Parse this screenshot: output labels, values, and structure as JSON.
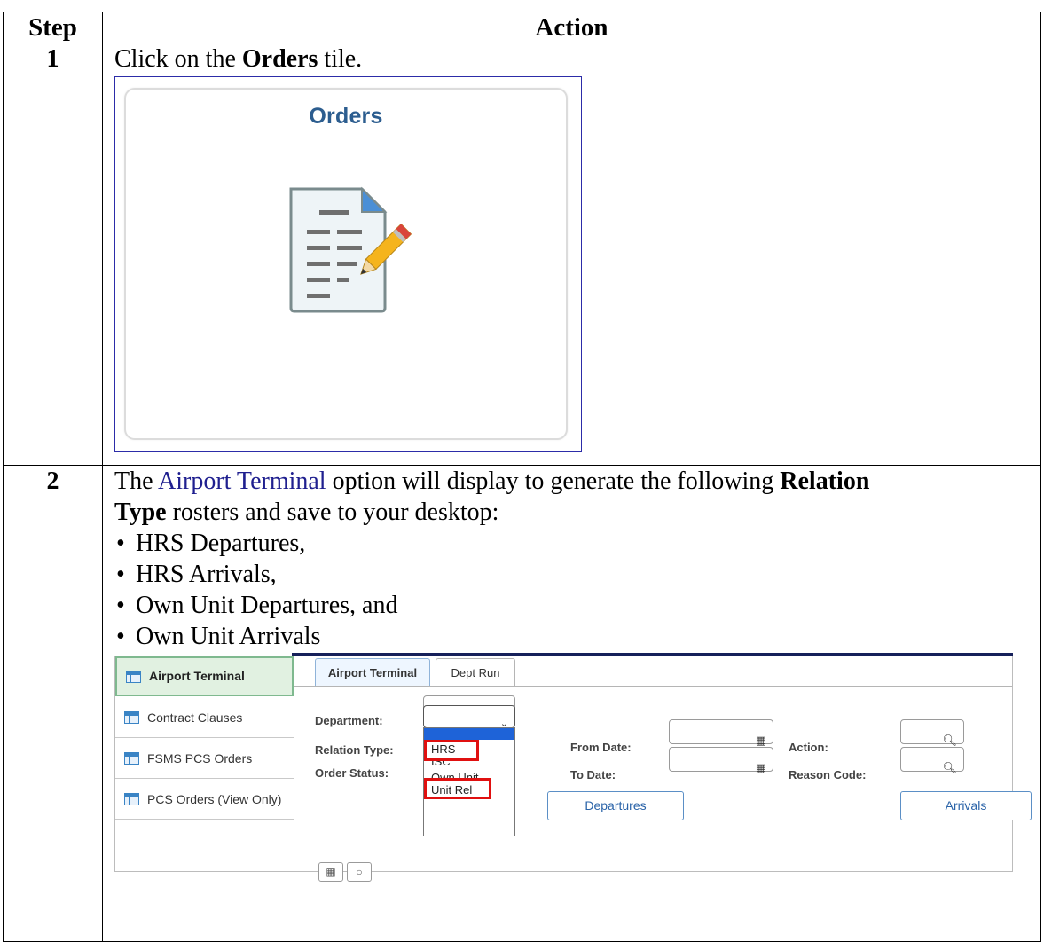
{
  "table": {
    "header_step": "Step",
    "header_action": "Action"
  },
  "step1": {
    "number": "1",
    "pre": "Click on the ",
    "bold": "Orders",
    "post": " tile.",
    "tile_title": "Orders",
    "tile_icon": "document-pencil-icon"
  },
  "step2": {
    "number": "2",
    "pre": "The ",
    "link_text": "Airport Terminal",
    "mid": " option will display to generate the following ",
    "bold1": "Relation",
    "bold2": "Type",
    "post": " rosters and save to your desktop:",
    "bullets": [
      "HRS Departures,",
      "HRS Arrivals,",
      "Own Unit Departures, and",
      "Own Unit Arrivals"
    ]
  },
  "screenshot": {
    "nav_items": [
      {
        "label": "Airport Terminal",
        "active": true
      },
      {
        "label": "Contract Clauses",
        "active": false
      },
      {
        "label": "FSMS PCS Orders",
        "active": false
      },
      {
        "label": "PCS Orders (View Only)",
        "active": false
      }
    ],
    "tabs": [
      "Airport Terminal",
      "Dept Run"
    ],
    "fields": {
      "department": "Department:",
      "relation_type": "Relation Type:",
      "order_status": "Order Status:",
      "from_date": "From Date:",
      "to_date": "To Date:",
      "action": "Action:",
      "reason_code": "Reason Code:"
    },
    "dropdown_options": [
      "HRS",
      "ISC",
      "Own Unit",
      "Unit Rel"
    ],
    "highlighted_options": [
      "HRS",
      "Own Unit"
    ],
    "buttons": {
      "departures": "Departures",
      "arrivals": "Arrivals"
    },
    "colors": {
      "highlight_box": "#e01010",
      "active_nav_bg": "#e1f1e1",
      "link_text": "#1f1f8f",
      "button_text": "#2a63a8"
    }
  }
}
